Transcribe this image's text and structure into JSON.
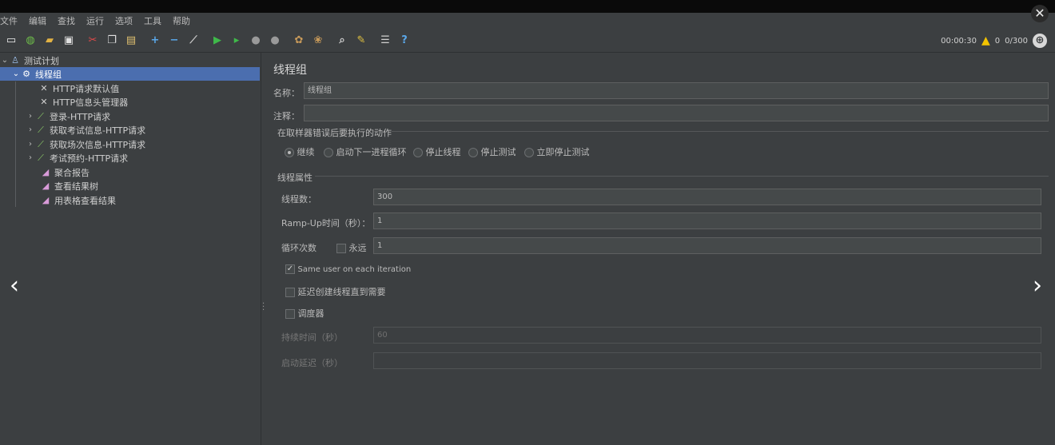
{
  "menu": [
    "文件",
    "编辑",
    "查找",
    "运行",
    "选项",
    "工具",
    "帮助"
  ],
  "toolbar": {
    "icons": [
      "new-icon",
      "templates-icon",
      "open-icon",
      "save-icon",
      "cut-icon",
      "copy-icon",
      "paste-icon",
      "expand-icon",
      "collapse-icon",
      "toggle-icon",
      "start-icon",
      "start-no-pause-icon",
      "stop-icon",
      "shutdown-icon",
      "clear-icon",
      "clear-all-icon",
      "search-icon",
      "reset-search-icon",
      "function-helper-icon",
      "help-icon"
    ],
    "timer": "00:00:30",
    "warnings": "0",
    "threads": "0/300"
  },
  "tree": {
    "root": "测试计划",
    "thread_group": "线程组",
    "children": [
      {
        "label": "HTTP请求默认值"
      },
      {
        "label": "HTTP信息头管理器"
      },
      {
        "label": "登录-HTTP请求"
      },
      {
        "label": "获取考试信息-HTTP请求"
      },
      {
        "label": "获取场次信息-HTTP请求"
      },
      {
        "label": "考试预约-HTTP请求"
      },
      {
        "label": "聚合报告"
      },
      {
        "label": "查看结果树"
      },
      {
        "label": "用表格查看结果"
      }
    ]
  },
  "panel": {
    "title": "线程组",
    "name_label": "名称：",
    "name_value": "线程组",
    "comment_label": "注释：",
    "comment_value": "",
    "on_error_label": "在取样器错误后要执行的动作",
    "on_error_options": [
      "继续",
      "启动下一进程循环",
      "停止线程",
      "停止测试",
      "立即停止测试"
    ],
    "on_error_selected": "继续",
    "thread_props_label": "线程属性",
    "threads_label": "线程数：",
    "threads_value": "300",
    "rampup_label": "Ramp-Up时间（秒）：",
    "rampup_value": "1",
    "loop_label": "循环次数",
    "forever_label": "永远",
    "loop_value": "1",
    "same_user_label": "Same user on each iteration",
    "delay_label": "延迟创建线程直到需要",
    "scheduler_label": "调度器",
    "duration_label": "持续时间（秒）",
    "duration_value": "60",
    "startup_delay_label": "启动延迟（秒）",
    "startup_delay_value": ""
  },
  "nav": {
    "prev": "‹",
    "next": "›"
  }
}
